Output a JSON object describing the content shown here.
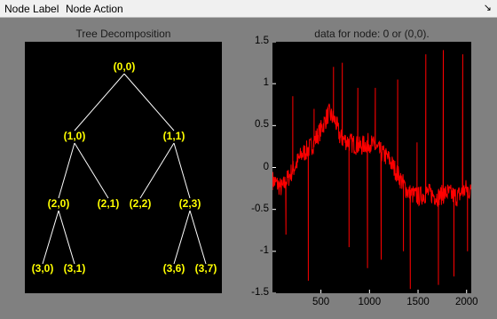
{
  "menu": {
    "node_label": "Node Label",
    "node_action": "Node Action",
    "corner_icon": "arrow-icon"
  },
  "tree_panel": {
    "title": "Tree Decomposition",
    "nodes": [
      {
        "id": "n00",
        "label": "(0,0)"
      },
      {
        "id": "n10",
        "label": "(1,0)"
      },
      {
        "id": "n11",
        "label": "(1,1)"
      },
      {
        "id": "n20",
        "label": "(2,0)"
      },
      {
        "id": "n21",
        "label": "(2,1)"
      },
      {
        "id": "n22",
        "label": "(2,2)"
      },
      {
        "id": "n23",
        "label": "(2,3)"
      },
      {
        "id": "n30",
        "label": "(3,0)"
      },
      {
        "id": "n31",
        "label": "(3,1)"
      },
      {
        "id": "n36",
        "label": "(3,6)"
      },
      {
        "id": "n37",
        "label": "(3,7)"
      }
    ],
    "colors": {
      "node_text": "#ffff00",
      "edge": "#ffffff",
      "background": "#000000"
    }
  },
  "plot_panel": {
    "title": "data for node: 0 or (0,0).",
    "line_color": "#ff0000"
  },
  "chart_data": {
    "type": "line",
    "title": "data for node: 0 or (0,0).",
    "xlabel": "",
    "ylabel": "",
    "xlim": [
      1,
      2048
    ],
    "ylim": [
      -1.5,
      1.5
    ],
    "xticks": [
      500,
      1000,
      1500,
      2000
    ],
    "yticks": [
      1.5,
      1,
      0.5,
      0,
      -0.5,
      -1,
      -1.5
    ],
    "xtick_labels": [
      "500",
      "1000",
      "1500",
      "2000"
    ],
    "ytick_labels": [
      "1.5",
      "1",
      "0.5",
      "0",
      "-0.5",
      "-1",
      "-1.5"
    ],
    "grid": false,
    "series": [
      {
        "color": "#ff0000",
        "trend": [
          [
            1,
            -0.15
          ],
          [
            100,
            -0.25
          ],
          [
            200,
            -0.05
          ],
          [
            300,
            0.15
          ],
          [
            400,
            0.25
          ],
          [
            500,
            0.45
          ],
          [
            580,
            0.65
          ],
          [
            650,
            0.55
          ],
          [
            700,
            0.35
          ],
          [
            800,
            0.3
          ],
          [
            900,
            0.25
          ],
          [
            1000,
            0.3
          ],
          [
            1100,
            0.2
          ],
          [
            1200,
            0.1
          ],
          [
            1300,
            -0.1
          ],
          [
            1400,
            -0.3
          ],
          [
            1500,
            -0.35
          ],
          [
            1600,
            -0.3
          ],
          [
            1700,
            -0.35
          ],
          [
            1800,
            -0.3
          ],
          [
            1900,
            -0.35
          ],
          [
            2000,
            -0.25
          ],
          [
            2048,
            -0.3
          ]
        ],
        "noise_amplitude": 0.12,
        "spikes": [
          [
            140,
            -0.8
          ],
          [
            210,
            0.85
          ],
          [
            370,
            -1.35
          ],
          [
            430,
            0.7
          ],
          [
            630,
            1.2
          ],
          [
            720,
            1.25
          ],
          [
            790,
            -0.95
          ],
          [
            880,
            0.95
          ],
          [
            980,
            -1.2
          ],
          [
            1060,
            0.95
          ],
          [
            1120,
            -1.1
          ],
          [
            1290,
            1.05
          ],
          [
            1350,
            -1.0
          ],
          [
            1420,
            -1.45
          ],
          [
            1490,
            0.3
          ],
          [
            1580,
            1.35
          ],
          [
            1710,
            -1.4
          ],
          [
            1760,
            1.4
          ],
          [
            1870,
            -1.3
          ],
          [
            1960,
            1.35
          ],
          [
            2010,
            -1.0
          ]
        ]
      }
    ]
  }
}
